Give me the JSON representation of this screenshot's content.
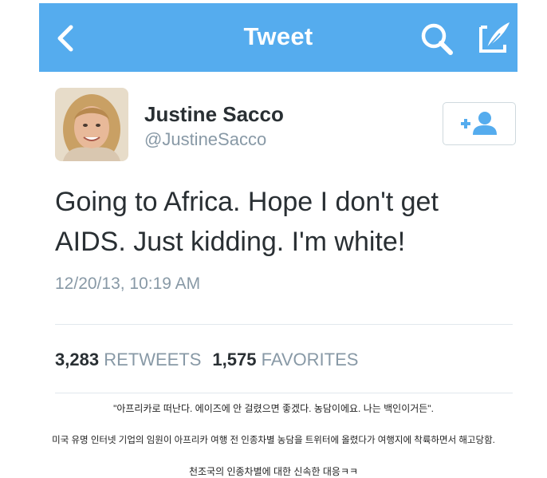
{
  "header": {
    "title": "Tweet",
    "color": "#55acee"
  },
  "icons": [
    "back-arrow-icon",
    "search-icon",
    "compose-icon",
    "follow-user-icon"
  ],
  "user": {
    "name": "Justine Sacco",
    "handle": "@JustineSacco"
  },
  "tweet": {
    "text": "Going to Africa. Hope I don't get AIDS. Just kidding. I'm white!",
    "timestamp": "12/20/13, 10:19 AM"
  },
  "stats": {
    "retweets_count": "3,283",
    "retweets_label": "RETWEETS",
    "favorites_count": "1,575",
    "favorites_label": "FAVORITES"
  },
  "captions": [
    "\"아프리카로 떠난다. 에이즈에 안 걸렸으면 좋겠다. 농담이에요. 나는 백인이거든\".",
    "미국 유명 인터넷 기업의 임원이 아프리카 여행 전 인종차별 농담을 트위터에 올렸다가 여행지에 착륙하면서 해고당함.",
    "천조국의 인종차별에 대한 신속한 대응ㅋㅋ"
  ]
}
